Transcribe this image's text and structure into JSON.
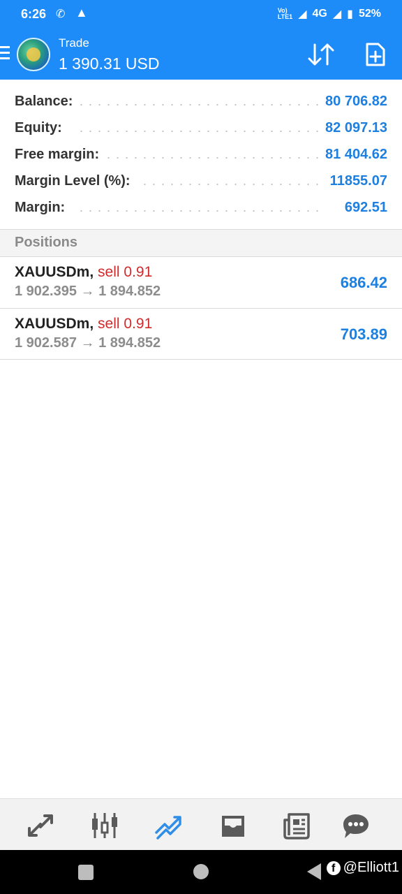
{
  "status_bar": {
    "time": "6:26",
    "network_label": "4G",
    "volte_label": "Vo))\nLTE1",
    "battery": "52%"
  },
  "header": {
    "title": "Trade",
    "amount": "1 390.31 USD"
  },
  "summary": [
    {
      "label": "Balance:",
      "value": "80 706.82"
    },
    {
      "label": "Equity:",
      "value": "82 097.13"
    },
    {
      "label": "Free margin:",
      "value": "81 404.62"
    },
    {
      "label": "Margin Level (%):",
      "value": "11855.07"
    },
    {
      "label": "Margin:",
      "value": "692.51"
    }
  ],
  "positions_header": "Positions",
  "positions": [
    {
      "symbol": "XAUUSDm,",
      "side": "sell 0.91",
      "prices": "1 902.395 → 1 894.852",
      "profit": "686.42"
    },
    {
      "symbol": "XAUUSDm,",
      "side": "sell 0.91",
      "prices": "1 902.587 → 1 894.852",
      "profit": "703.89"
    }
  ],
  "bottom_nav": [
    {
      "name": "quotes",
      "icon": "arrows-exchange-icon"
    },
    {
      "name": "chart",
      "icon": "candlestick-icon"
    },
    {
      "name": "trade",
      "icon": "trend-lines-icon",
      "active": true
    },
    {
      "name": "history",
      "icon": "inbox-icon"
    },
    {
      "name": "news",
      "icon": "newspaper-icon"
    },
    {
      "name": "messages",
      "icon": "chat-bubble-icon"
    }
  ],
  "watermark": "@Elliott1",
  "colors": {
    "header_bg": "#1d8cf8",
    "value_blue": "#1d7fe0",
    "sell_red": "#d02b2b",
    "active_nav": "#2f8ee8",
    "inactive_nav": "#5a5a5a"
  }
}
